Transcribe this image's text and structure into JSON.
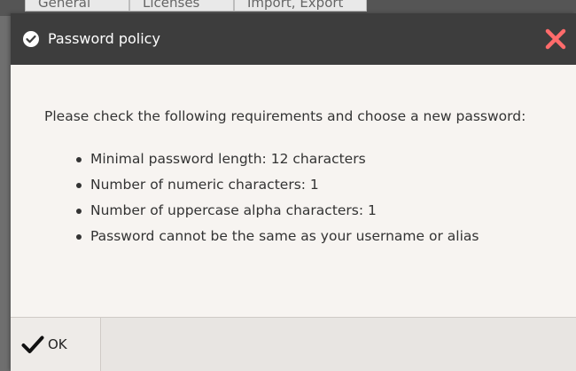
{
  "background": {
    "tabs": [
      "General",
      "Licenses",
      "Import, Export"
    ]
  },
  "dialog": {
    "title": "Password policy",
    "title_icon": "check-circle-icon",
    "close_icon": "close-icon",
    "intro": "Please check the following requirements and choose a new password:",
    "requirements": [
      "Minimal password length: 12 characters",
      "Number of numeric characters: 1",
      "Number of uppercase alpha characters: 1",
      "Password cannot be the same as your username or alias"
    ],
    "ok_button": {
      "label": "OK",
      "icon": "checkmark-icon"
    }
  },
  "colors": {
    "titlebar": "#3d3d3d",
    "close": "#ff6b6b",
    "content_bg": "#f7f4f1",
    "footer_bg": "#e8e5e2"
  }
}
